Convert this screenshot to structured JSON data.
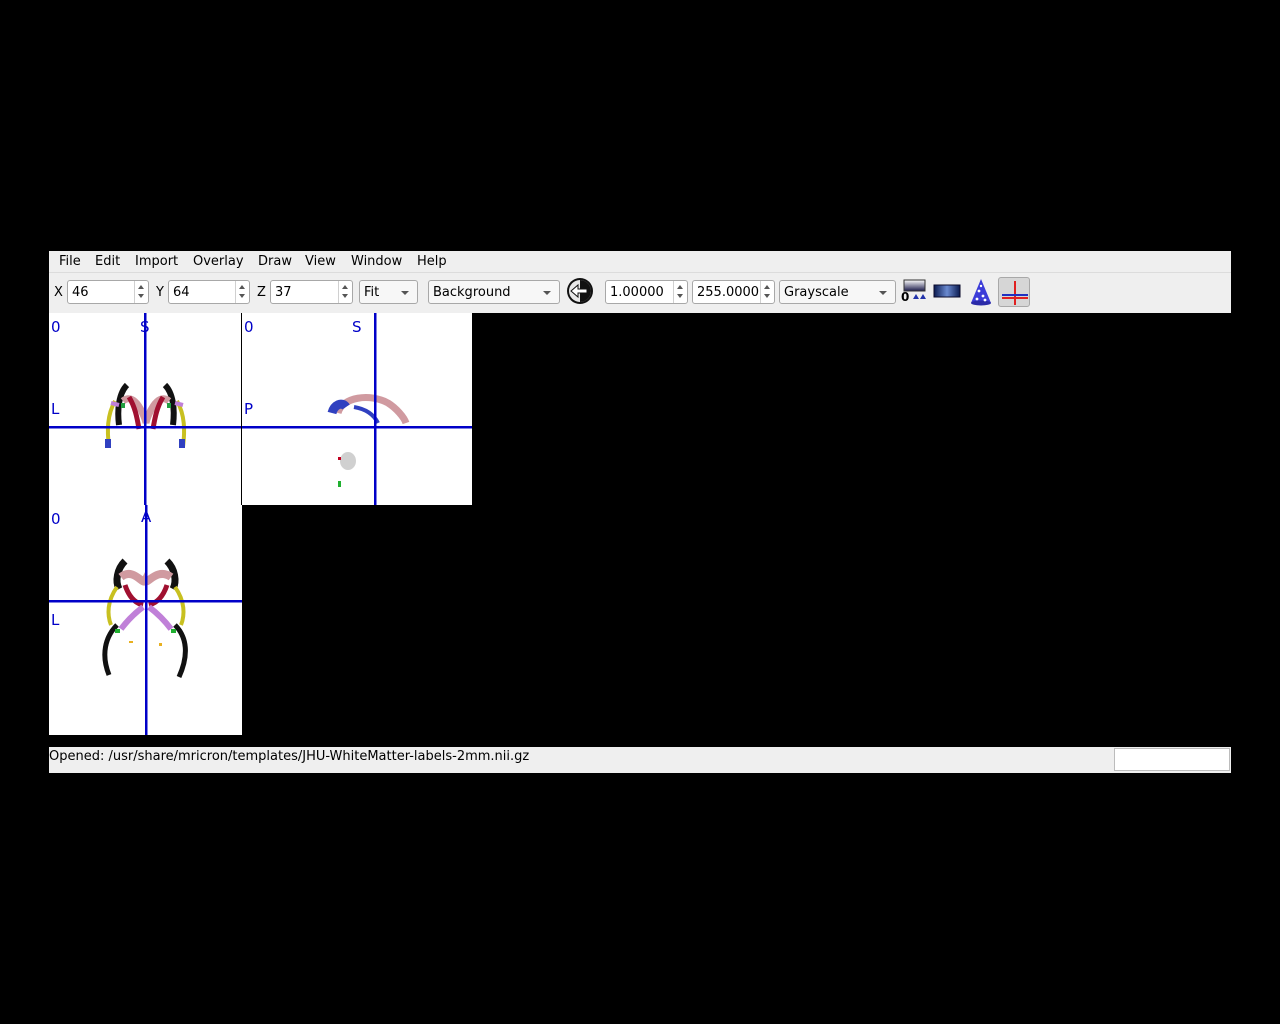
{
  "menu": {
    "file": "File",
    "edit": "Edit",
    "import": "Import",
    "overlay": "Overlay",
    "draw": "Draw",
    "view": "View",
    "window": "Window",
    "help": "Help"
  },
  "toolbar": {
    "x_label": "X",
    "x_value": "46",
    "y_label": "Y",
    "y_value": "64",
    "z_label": "Z",
    "z_value": "37",
    "zoom_value": "Fit",
    "layer_value": "Background",
    "min_value": "1.00000",
    "max_value": "255.0000",
    "colorscheme_value": "Grayscale",
    "icons": [
      "undo-icon",
      "color-adjust-icon",
      "gradient-bar-icon",
      "render-icon",
      "crosshair-icon"
    ]
  },
  "views": {
    "coronal": {
      "corner": "0",
      "top": "S",
      "left": "L"
    },
    "sagittal": {
      "corner": "0",
      "top": "S",
      "left": "P"
    },
    "axial": {
      "corner": "0",
      "top": "A",
      "left": "L"
    },
    "crosshair_color": "#0000c8"
  },
  "status": {
    "text": "Opened: /usr/share/mricron/templates/JHU-WhiteMatter-labels-2mm.nii.gz",
    "right_panel": ""
  }
}
